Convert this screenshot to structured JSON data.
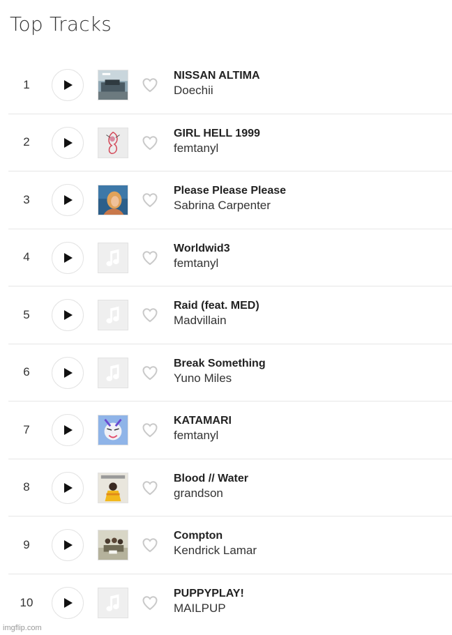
{
  "page": {
    "title": "Top Tracks"
  },
  "watermark": "imgflip.com",
  "icons": {
    "play": "play-icon",
    "like": "heart-icon",
    "placeholder_art": "music-note-icon"
  },
  "colors": {
    "text": "#222222",
    "border": "#e6e6e6",
    "heart": "#cfcfcf"
  },
  "tracks": [
    {
      "rank": "1",
      "title": "NISSAN ALTIMA",
      "artist": "Doechii",
      "art": "nissan"
    },
    {
      "rank": "2",
      "title": "GIRL HELL 1999",
      "artist": "femtanyl",
      "art": "girlhell"
    },
    {
      "rank": "3",
      "title": "Please Please Please",
      "artist": "Sabrina Carpenter",
      "art": "sabrina"
    },
    {
      "rank": "4",
      "title": "Worldwid3",
      "artist": "femtanyl",
      "art": "placeholder"
    },
    {
      "rank": "5",
      "title": "Raid (feat. MED)",
      "artist": "Madvillain",
      "art": "placeholder"
    },
    {
      "rank": "6",
      "title": "Break Something",
      "artist": "Yuno Miles",
      "art": "placeholder"
    },
    {
      "rank": "7",
      "title": "KATAMARI",
      "artist": "femtanyl",
      "art": "katamari"
    },
    {
      "rank": "8",
      "title": "Blood // Water",
      "artist": "grandson",
      "art": "grandson"
    },
    {
      "rank": "9",
      "title": "Compton",
      "artist": "Kendrick Lamar",
      "art": "compton"
    },
    {
      "rank": "10",
      "title": "PUPPYPLAY!",
      "artist": "MAILPUP",
      "art": "placeholder"
    }
  ]
}
